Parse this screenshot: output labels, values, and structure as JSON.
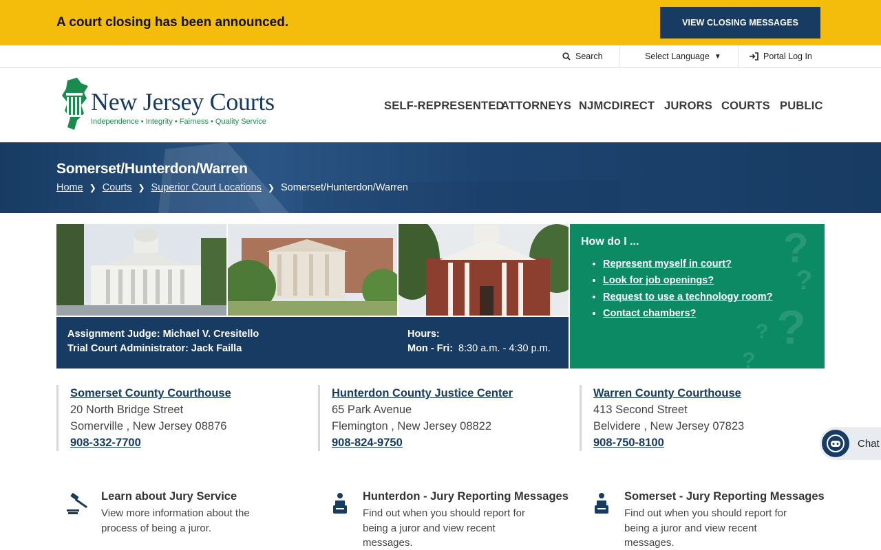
{
  "alert": {
    "text": "A court closing has been announced.",
    "button": "VIEW CLOSING MESSAGES"
  },
  "utility": {
    "search": "Search",
    "language": "Select Language",
    "portal": "Portal Log In"
  },
  "logo": {
    "title": "New Jersey Courts",
    "tagline": "Independence • Integrity • Fairness • Quality Service"
  },
  "nav": [
    "SELF-REPRESENTED",
    "ATTORNEYS",
    "NJMCDIRECT",
    "JURORS",
    "COURTS",
    "PUBLIC"
  ],
  "banner": {
    "title": "Somerset/Hunterdon/Warren",
    "breadcrumbs": [
      "Home",
      "Courts",
      "Superior Court Locations"
    ],
    "current": "Somerset/Hunterdon/Warren"
  },
  "info": {
    "judge": "Assignment Judge: Michael V. Cresitello",
    "administrator": "Trial Court Administrator: Jack Failla",
    "hours_label": "Hours:",
    "days": "Mon - Fri:",
    "times": "8:30 a.m. - 4:30 p.m."
  },
  "howto": {
    "title": "How do I ...",
    "items": [
      "Represent myself in court?",
      "Look for job openings?",
      "Request to use a technology room?",
      "Contact chambers?"
    ]
  },
  "locations": [
    {
      "name": "Somerset County Courthouse",
      "street": "20 North Bridge Street",
      "city": "Somerville , New Jersey 08876",
      "phone": "908-332-7700"
    },
    {
      "name": "Hunterdon County Justice Center",
      "street": "65 Park Avenue",
      "city": "Flemington , New Jersey 08822",
      "phone": "908-824-9750"
    },
    {
      "name": "Warren County Courthouse",
      "street": "413 Second Street",
      "city": "Belvidere , New Jersey 07823",
      "phone": "908-750-8100"
    }
  ],
  "links": [
    {
      "title": "Learn about Jury Service",
      "desc": "View more information about the process of being a juror.",
      "icon": "gavel-icon"
    },
    {
      "title": "Hunterdon - Jury Reporting Messages",
      "desc": "Find out when you should report for being a juror and view recent messages.",
      "icon": "juror-icon"
    },
    {
      "title": "Somerset - Jury Reporting Messages",
      "desc": "Find out when you should report for being a juror and view recent messages.",
      "icon": "juror-icon"
    }
  ],
  "chat": {
    "label": "Chat"
  },
  "colors": {
    "alert": "#f4bd0b",
    "navy": "#173b62",
    "green": "#0b8a63"
  }
}
